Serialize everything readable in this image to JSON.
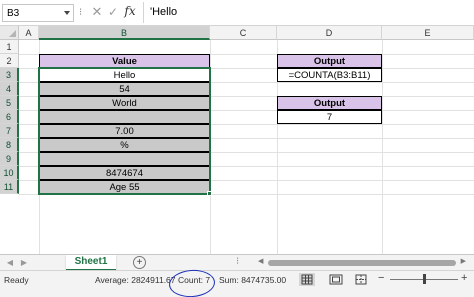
{
  "formula_bar": {
    "name_box": "B3",
    "separator": "⁝",
    "cancel_icon": "✕",
    "enter_icon": "✓",
    "fx_label": "fx",
    "formula": "'Hello"
  },
  "columns": [
    "A",
    "B",
    "C",
    "D",
    "E"
  ],
  "rows": [
    "1",
    "2",
    "3",
    "4",
    "5",
    "6",
    "7",
    "8",
    "9",
    "10",
    "11"
  ],
  "selected_column": "B",
  "selected_rows": [
    "3",
    "4",
    "5",
    "6",
    "7",
    "8",
    "9",
    "10",
    "11"
  ],
  "table": {
    "header": "Value",
    "values": [
      "Hello",
      "54",
      "World",
      "",
      "7.00",
      "%",
      "",
      "8474674",
      "Age 55"
    ]
  },
  "output1": {
    "header": "Output",
    "value": "=COUNTA(B3:B11)"
  },
  "output2": {
    "header": "Output",
    "value": "7"
  },
  "tabs": {
    "sheet_name": "Sheet1",
    "add_icon": "+",
    "more": "⁝"
  },
  "status_bar": {
    "ready": "Ready",
    "average": "Average: 2824911.67",
    "count": "Count: 7",
    "sum": "Sum: 8474735.00",
    "zoom_minus": "−",
    "zoom_plus": "+"
  },
  "colors": {
    "accent": "#217346",
    "header_fill": "#d9c3e9",
    "data_fill": "#c9c9c9",
    "annotation": "#1a2fb8"
  },
  "icons": [
    "chevron-down-icon",
    "cancel-icon",
    "enter-icon",
    "insert-function-icon",
    "select-all-icon",
    "tab-prev-icon",
    "tab-next-icon",
    "add-sheet-icon",
    "normal-view-icon",
    "page-layout-icon",
    "page-break-icon"
  ]
}
